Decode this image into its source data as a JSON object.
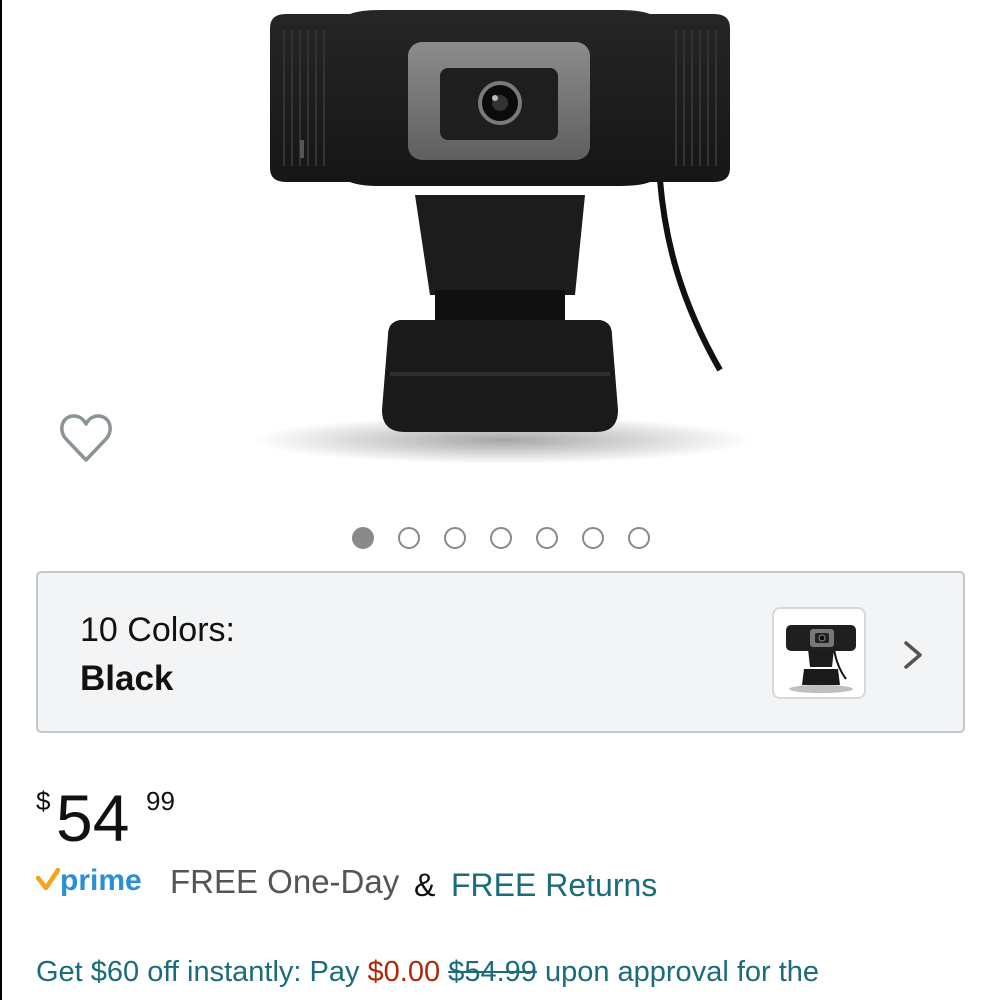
{
  "product": {
    "image_alt": "webcam-image",
    "carousel": {
      "total": 7,
      "active_index": 0
    }
  },
  "colors": {
    "label": "10 Colors:",
    "selected": "Black"
  },
  "price": {
    "currency": "$",
    "whole": "54",
    "fraction": "99"
  },
  "shipping": {
    "prime_brand": "prime",
    "delivery": "FREE One-Day",
    "amp": "&",
    "returns": "FREE Returns"
  },
  "promo": {
    "lead": "Get $60 off instantly: Pay ",
    "pay_amount": "$0.00",
    "original_amount": "$54.99",
    "tail": " upon approval for the"
  },
  "icons": {
    "wishlist": "heart-outline-icon",
    "chevron": "chevron-right-icon",
    "prime_check": "prime-checkmark-icon"
  },
  "colors_palette": {
    "link": "#1a6c7a",
    "price_red": "#b12704",
    "prime_orange": "#f7a21b",
    "prime_blue": "#2a8fd6"
  }
}
